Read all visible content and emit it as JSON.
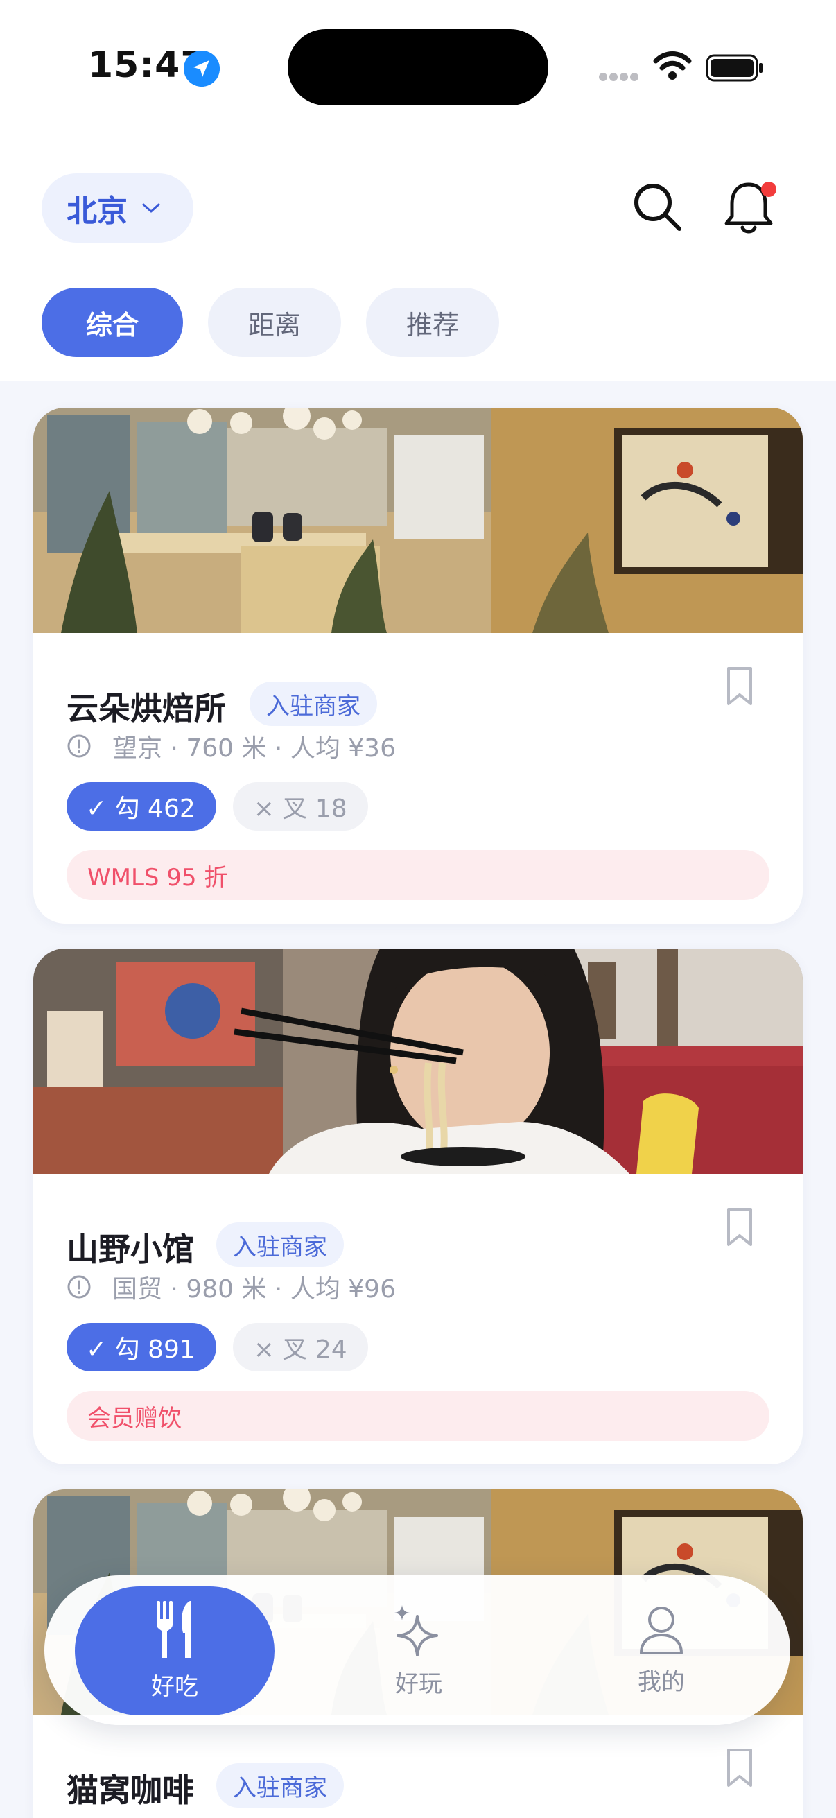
{
  "status_bar": {
    "time": "15:47"
  },
  "header": {
    "city": "北京",
    "tabs": [
      {
        "label": "综合",
        "active": true
      },
      {
        "label": "距离",
        "active": false
      },
      {
        "label": "推荐",
        "active": false
      }
    ],
    "has_notification": true
  },
  "cards": [
    {
      "name": "云朵烘焙所",
      "badge": "入驻商家",
      "info": "望京 · 760 米 · 人均 ¥36",
      "up_label": "✓ 勾 462",
      "down_label": "× 叉 18",
      "promo": "WMLS 95 折",
      "photo": "cafe-interior"
    },
    {
      "name": "山野小馆",
      "badge": "入驻商家",
      "info": "国贸 · 980 米 · 人均 ¥96",
      "up_label": "✓ 勾 891",
      "down_label": "× 叉 24",
      "promo": "会员赠饮",
      "photo": "woman-eating-noodles"
    },
    {
      "name": "猫窝咖啡",
      "badge": "入驻商家",
      "info": "",
      "photo": "cafe-interior"
    }
  ],
  "bottom_nav": [
    {
      "label": "好吃",
      "icon": "fork-knife-icon",
      "active": true
    },
    {
      "label": "好玩",
      "icon": "sparkle-icon",
      "active": false
    },
    {
      "label": "我的",
      "icon": "person-icon",
      "active": false
    }
  ],
  "colors": {
    "accent": "#4c6ee6",
    "promo_text": "#f0506a",
    "promo_bg": "#fdecee",
    "badge_bg": "#eef2fd",
    "notification_dot": "#f23c3c"
  }
}
